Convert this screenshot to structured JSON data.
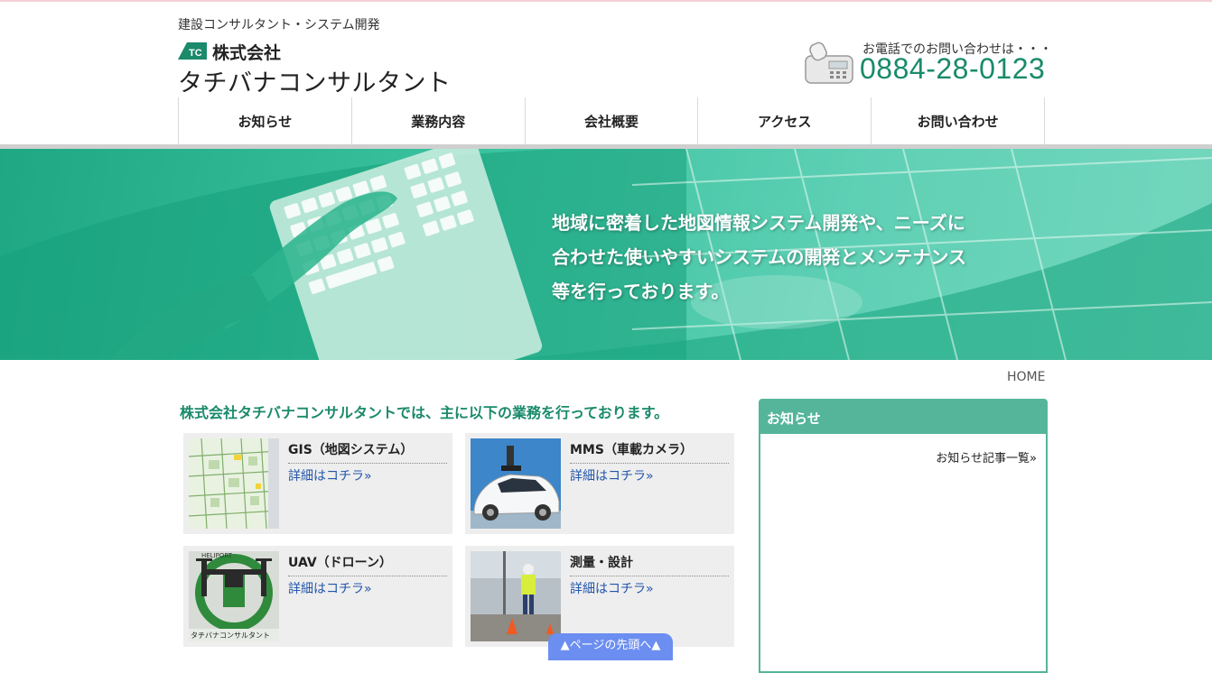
{
  "header": {
    "tagline": "建設コンサルタント・システム開発",
    "company_type": "株式会社",
    "company_name": "タチバナコンサルタント",
    "logo_mark_text": "TC",
    "phone_lead": "お電話でのお問い合わせは・・・",
    "phone_number": "0884-28-0123"
  },
  "nav": {
    "items": [
      "お知らせ",
      "業務内容",
      "会社概要",
      "アクセス",
      "お問い合わせ"
    ]
  },
  "hero": {
    "lines": [
      "地域に密着した地図情報システム開発や、ニーズに",
      "合わせた使いやすいシステムの開発とメンテナンス",
      "等を行っております。"
    ]
  },
  "breadcrumb": {
    "home": "HOME"
  },
  "main": {
    "intro": "株式会社タチバナコンサルタントでは、主に以下の業務を行っております。",
    "services": [
      {
        "title": "GIS（地図システム）",
        "link": "詳細はコチラ»"
      },
      {
        "title": "MMS（車載カメラ）",
        "link": "詳細はコチラ»"
      },
      {
        "title": "UAV（ドローン）",
        "link": "詳細はコチラ»",
        "thumb_text": "タチバナコンサルタント"
      },
      {
        "title": "測量・設計",
        "link": "詳細はコチラ»"
      }
    ]
  },
  "sidebar": {
    "news_title": "お知らせ",
    "news_link": "お知らせ記事一覧»"
  },
  "page_top": "▲ページの先頭へ▲",
  "colors": {
    "accent": "#1a8a6b",
    "panel": "#55b59b",
    "link": "#2255aa",
    "pagetop": "#6b8ef0"
  }
}
